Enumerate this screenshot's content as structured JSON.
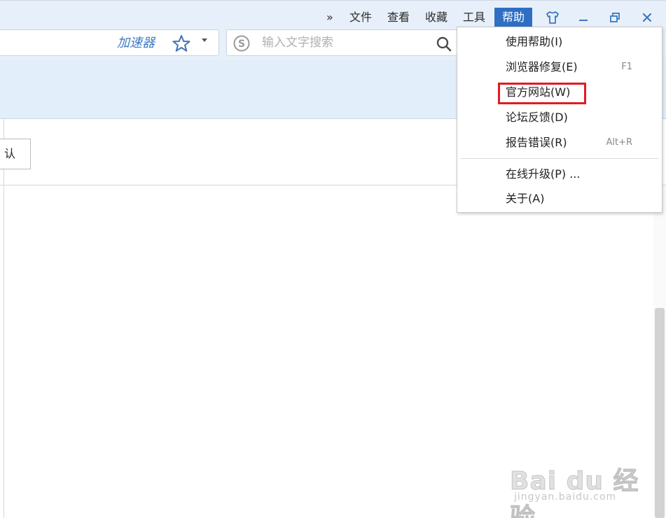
{
  "menubar": {
    "overflow": "»",
    "items": [
      "文件",
      "查看",
      "收藏",
      "工具"
    ],
    "active_item": "帮助"
  },
  "address_bar": {
    "accelerator_label": "加速器"
  },
  "search": {
    "placeholder": "输入文字搜索"
  },
  "content": {
    "confirm_label": "认"
  },
  "help_menu": {
    "items": [
      {
        "label": "使用帮助(I)",
        "shortcut": ""
      },
      {
        "label": "浏览器修复(E)",
        "shortcut": "F1"
      },
      {
        "label": "官方网站(W)",
        "shortcut": ""
      },
      {
        "label": "论坛反馈(D)",
        "shortcut": ""
      },
      {
        "label": "报告错误(R)",
        "shortcut": "Alt+R"
      },
      {
        "label": "在线升级(P) ...",
        "shortcut": ""
      },
      {
        "label": "关于(A)",
        "shortcut": ""
      }
    ],
    "highlighted_item": "官方网站(W)",
    "highlight_color": "#e21b22"
  },
  "watermark": {
    "brand": "Bai du 经验",
    "url": "jingyan.baidu.com"
  },
  "icons": {
    "skin": "tshirt-icon",
    "minimize": "minimize-icon",
    "restore": "restore-icon",
    "close": "close-icon",
    "favorite": "star-icon",
    "search_engine": "sogou-icon",
    "search": "search-icon"
  },
  "colors": {
    "accent": "#2e6fc4",
    "toolbar_bg": "#e7f0fa"
  }
}
